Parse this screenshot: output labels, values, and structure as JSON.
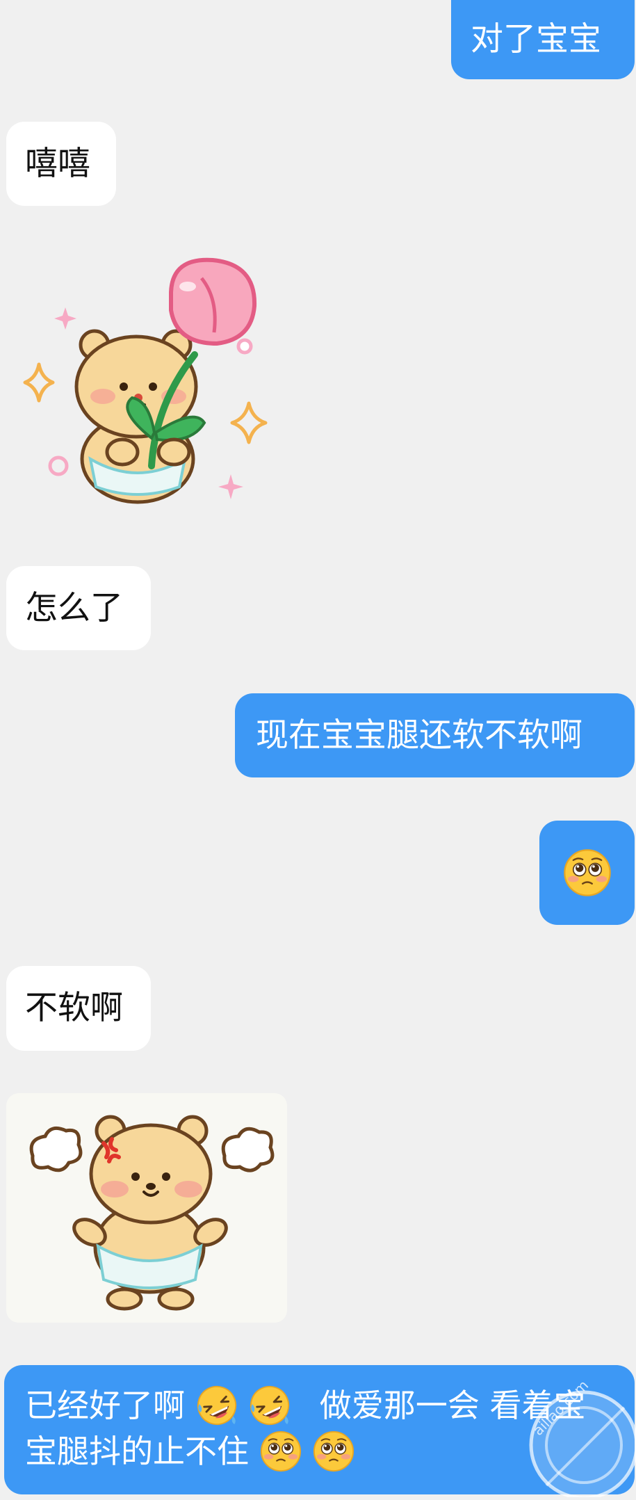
{
  "messages": {
    "m1_text": "对了宝宝",
    "m2_text": "嘻嘻",
    "m3_sticker": "bear-with-tulip-sticker",
    "m4_text": "怎么了",
    "m5_text": "现在宝宝腿还软不软啊",
    "m6_emoji": "pleading-face-emoji",
    "m7_text": "不软啊",
    "m8_sticker": "angry-bear-sticker",
    "m9": {
      "line1_a": "已经好了啊",
      "line1_b": "做爱那一会 看着宝",
      "line2_a": "宝腿抖的止不住",
      "emojis": [
        "rolling-laughing-emoji",
        "rolling-laughing-emoji",
        "pleading-face-emoji",
        "pleading-face-emoji"
      ]
    }
  },
  "colors": {
    "outgoing_bubble": "#3d98f5",
    "incoming_bubble": "#ffffff",
    "background": "#f0f0f0"
  },
  "watermark": {
    "text": "ailiao.com"
  }
}
